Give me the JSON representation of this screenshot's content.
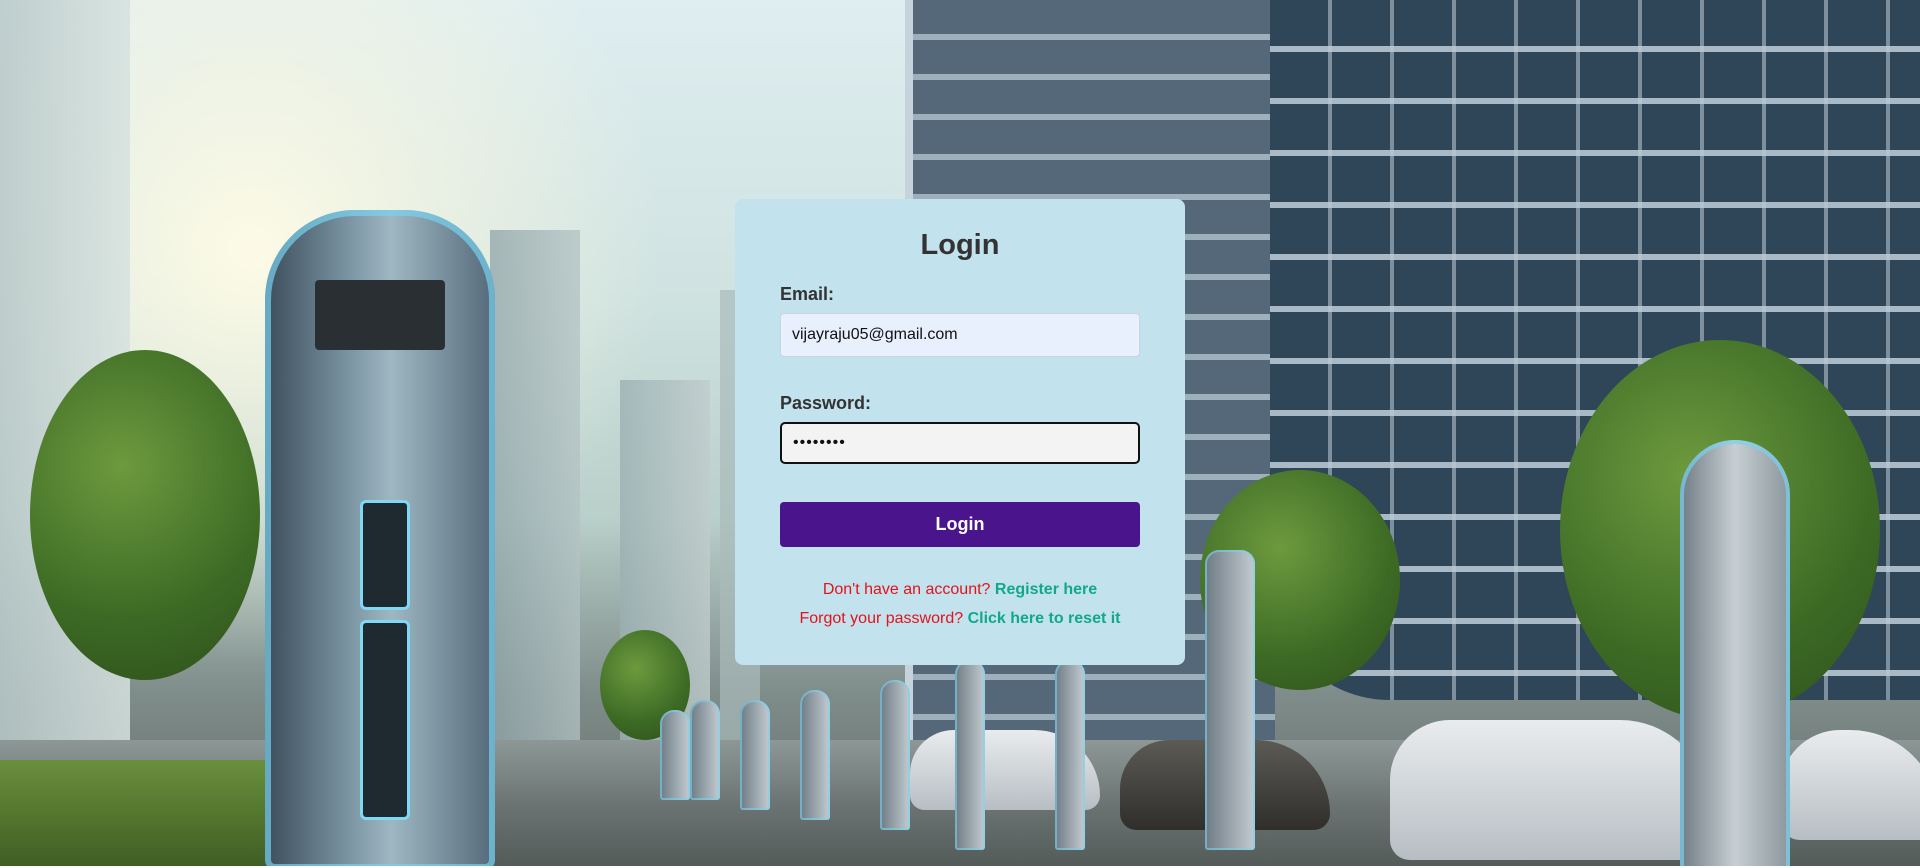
{
  "login": {
    "title": "Login",
    "email_label": "Email:",
    "email_value": "vijayraju05@gmail.com",
    "password_label": "Password:",
    "password_value": "••••••••",
    "button_label": "Login",
    "register_prompt": "Don't have an account?",
    "register_link": "Register here",
    "reset_prompt": "Forgot your password?",
    "reset_link": "Click here to reset it"
  },
  "colors": {
    "card_background": "#c2e2ee",
    "button_background": "#4a148c",
    "prompt_text": "#e4121b",
    "link_text": "#12a88a"
  },
  "background": {
    "icon": "ev-charging-city-scene"
  }
}
